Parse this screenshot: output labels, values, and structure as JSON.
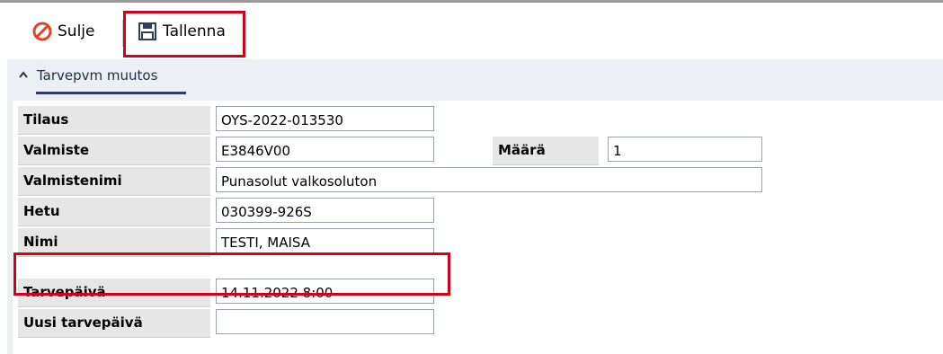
{
  "toolbar": {
    "close_label": "Sulje",
    "save_label": "Tallenna"
  },
  "section": {
    "title": "Tarvepvm muutos"
  },
  "fields": {
    "tilaus": {
      "label": "Tilaus",
      "value": "OYS-2022-013530"
    },
    "valmiste": {
      "label": "Valmiste",
      "value": "E3846V00"
    },
    "maara": {
      "label": "Määrä",
      "value": "1"
    },
    "valmistenimi": {
      "label": "Valmistenimi",
      "value": "Punasolut valkosoluton"
    },
    "hetu": {
      "label": "Hetu",
      "value": "030399-926S"
    },
    "nimi": {
      "label": "Nimi",
      "value": "TESTI, MAISA"
    },
    "tarvepaiva": {
      "label": "Tarvepäivä",
      "value": "14.11.2022 8:00"
    },
    "uusi_tarvepaiva": {
      "label": "Uusi tarvepäivä",
      "value": ""
    }
  },
  "colors": {
    "highlight": "#d0021b",
    "close_icon": "#e4432b",
    "tab_underline": "#2f3e5c"
  },
  "icons": {
    "close": "no-entry-icon",
    "save": "floppy-disk-icon",
    "collapse": "chevron-up-icon"
  }
}
